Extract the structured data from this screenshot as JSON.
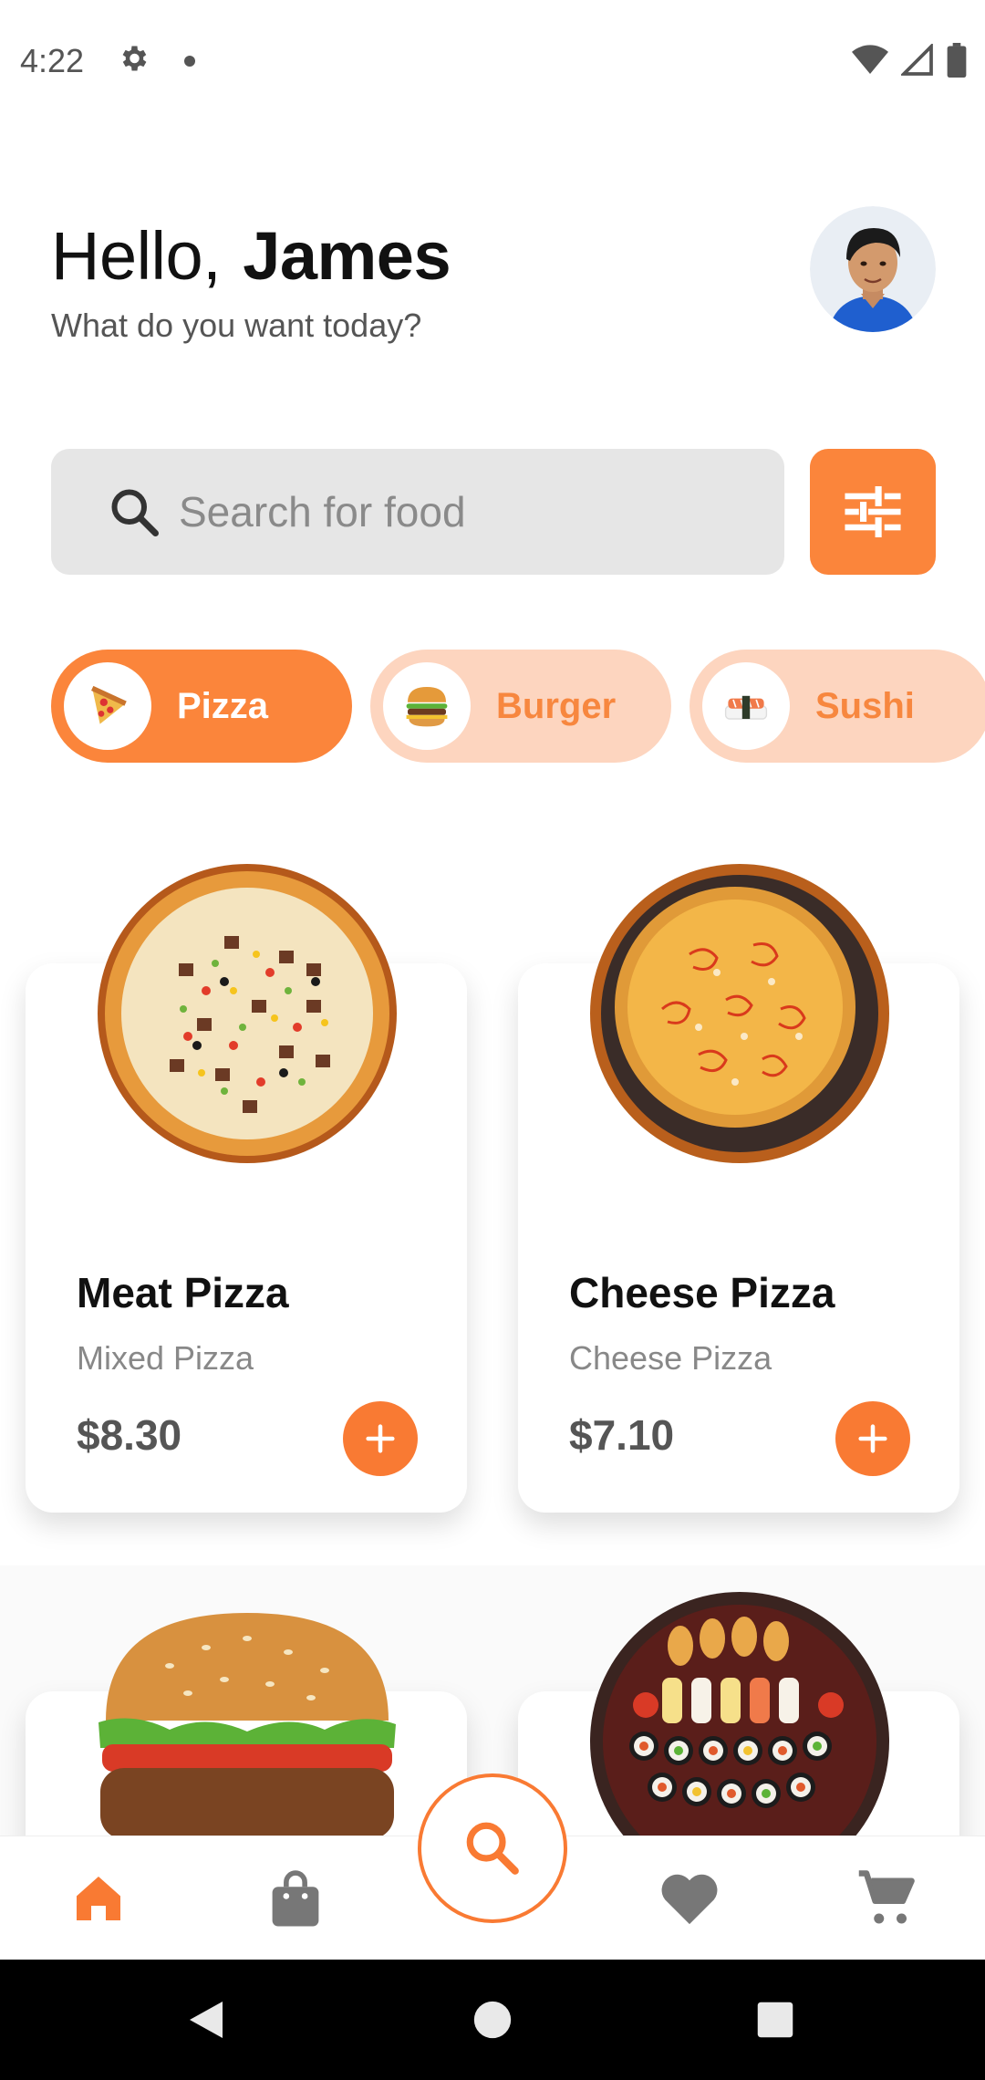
{
  "status_bar": {
    "time": "4:22",
    "icons": [
      "settings-icon",
      "notification-dot",
      "wifi-icon",
      "signal-icon",
      "battery-icon"
    ]
  },
  "header": {
    "greeting": "Hello,",
    "name": "James",
    "subtitle": "What do you want today?"
  },
  "search": {
    "placeholder": "Search for food"
  },
  "categories": [
    {
      "label": "Pizza",
      "icon": "pizza-icon",
      "active": true
    },
    {
      "label": "Burger",
      "icon": "burger-icon",
      "active": false
    },
    {
      "label": "Sushi",
      "icon": "sushi-icon",
      "active": false
    }
  ],
  "products": [
    {
      "title": "Meat Pizza",
      "subtitle": "Mixed Pizza",
      "price": "$8.30"
    },
    {
      "title": "Cheese Pizza",
      "subtitle": "Cheese Pizza",
      "price": "$7.10"
    }
  ],
  "nav": [
    "home-icon",
    "bag-icon",
    "search-icon",
    "heart-icon",
    "cart-icon"
  ],
  "colors": {
    "accent": "#fb853b",
    "accent_light": "#fdd5bf",
    "search_bg": "#e6e6e6"
  }
}
